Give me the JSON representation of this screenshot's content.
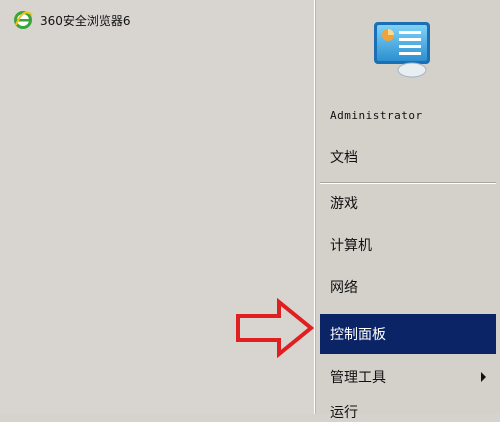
{
  "pinned": {
    "browser_label": "360安全浏览器6",
    "browser_icon": "ie-browser-icon"
  },
  "user": {
    "name": "Administrator",
    "picture_icon": "control-panel-user-icon"
  },
  "menu": {
    "documents": "文档",
    "games": "游戏",
    "computer": "计算机",
    "network": "网络",
    "control_panel": "控制面板",
    "admin_tools": "管理工具",
    "run_partial": "运行"
  },
  "annotation": {
    "arrow_icon": "red-arrow-icon",
    "arrow_color": "#e02020"
  },
  "colors": {
    "selected_bg": "#0b2466",
    "panel_bg": "#d6d3ce"
  }
}
